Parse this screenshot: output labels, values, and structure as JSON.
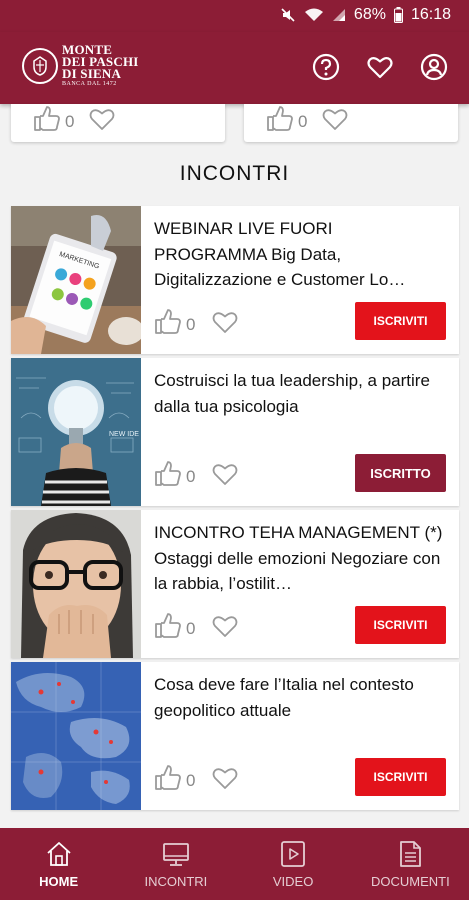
{
  "status_bar": {
    "battery_percent": "68%",
    "time": "16:18"
  },
  "header": {
    "logo_line1": "MONTE",
    "logo_line2": "DEI PASCHI",
    "logo_line3": "DI SIENA",
    "logo_tagline": "BANCA DAL 1472",
    "icons": [
      "help-icon",
      "favorites-icon",
      "account-icon"
    ]
  },
  "previous_cards": [
    {
      "like_count": "0"
    },
    {
      "like_count": "0"
    }
  ],
  "section_title": "INCONTRI",
  "events": [
    {
      "title": "WEBINAR LIVE FUORI PROGRAMMA Big Data, Digitalizzazione e Customer Lo…",
      "like_count": "0",
      "button_label": "ISCRIVITI",
      "status": "not-registered",
      "thumb_name": "marketing-tablet-image"
    },
    {
      "title": "Costruisci la tua leadership, a partire dalla tua psicologia",
      "like_count": "0",
      "button_label": "ISCRITTO",
      "status": "registered",
      "thumb_name": "lightbulb-head-image"
    },
    {
      "title": "INCONTRO TEHA MANAGEMENT (*) Ostaggi delle emozioni Negoziare con la rabbia, l’ostilit…",
      "like_count": "0",
      "button_label": "ISCRIVITI",
      "status": "not-registered",
      "thumb_name": "worried-woman-image"
    },
    {
      "title": "Cosa deve fare l’Italia nel contesto geopolitico attuale",
      "like_count": "0",
      "button_label": "ISCRIVITI",
      "status": "not-registered",
      "thumb_name": "world-map-image"
    }
  ],
  "bottom_nav": [
    {
      "label": "HOME",
      "icon": "home-icon",
      "active": true
    },
    {
      "label": "INCONTRI",
      "icon": "monitor-icon",
      "active": false
    },
    {
      "label": "VIDEO",
      "icon": "play-icon",
      "active": false
    },
    {
      "label": "DOCUMENTI",
      "icon": "document-icon",
      "active": false
    }
  ],
  "colors": {
    "brand": "#8c1d36",
    "cta": "#e3131b",
    "background": "#f2f2f2"
  }
}
